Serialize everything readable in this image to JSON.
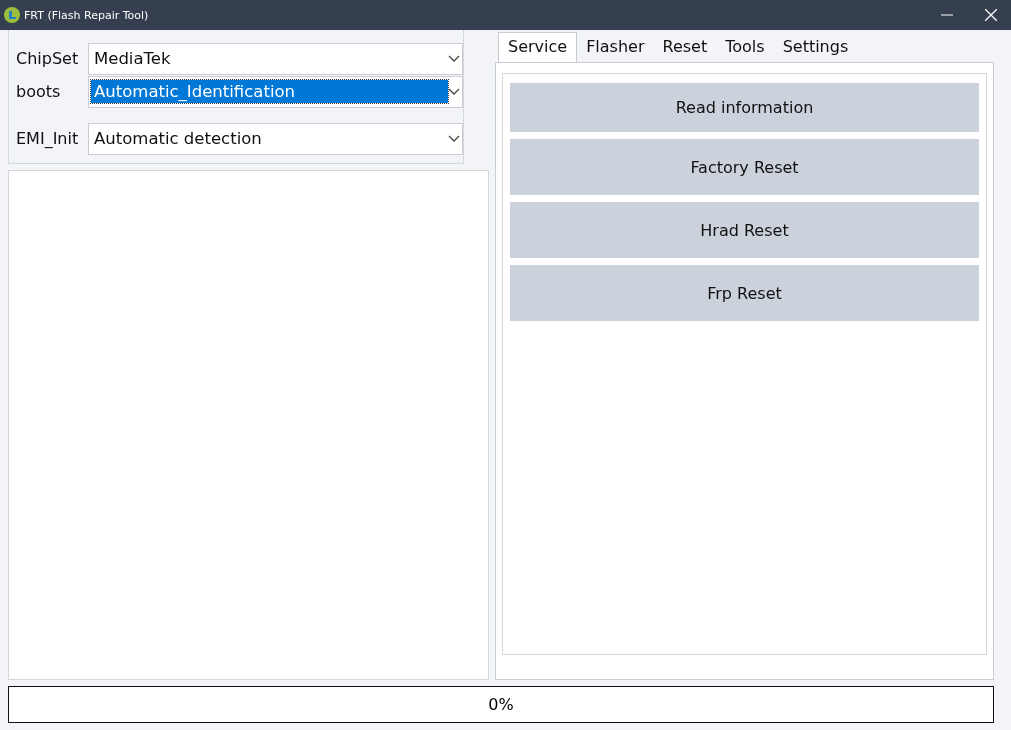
{
  "window": {
    "title": "FRT (Flash Repair Tool)"
  },
  "fields": [
    {
      "label": "ChipSet",
      "value": "MediaTek",
      "highlighted": false
    },
    {
      "label": "boots",
      "value": "Automatic_Identification",
      "highlighted": true
    },
    {
      "label": "EMI_Init",
      "value": "Automatic detection",
      "highlighted": false
    }
  ],
  "tabs": [
    {
      "label": "Service",
      "selected": true
    },
    {
      "label": "Flasher",
      "selected": false
    },
    {
      "label": "Reset",
      "selected": false
    },
    {
      "label": "Tools",
      "selected": false
    },
    {
      "label": "Settings",
      "selected": false
    }
  ],
  "buttons": [
    "Read information",
    "Factory Reset",
    "Hrad Reset",
    "Frp Reset"
  ],
  "progress": {
    "level": 0,
    "reading": "0%"
  }
}
